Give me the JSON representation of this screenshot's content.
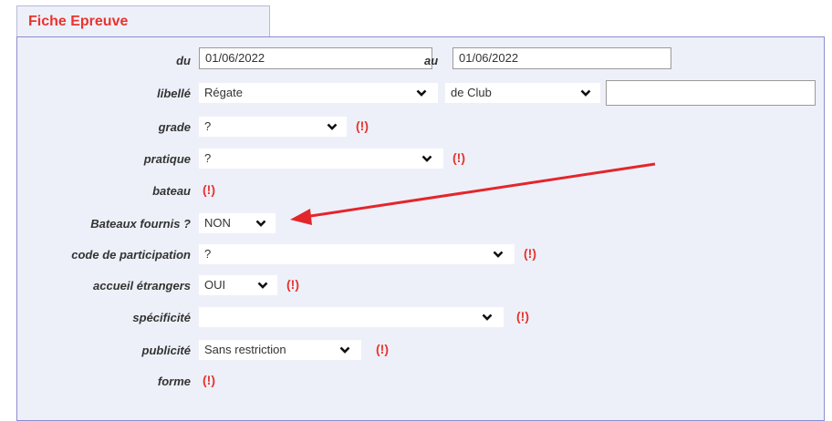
{
  "tab": {
    "title": "Fiche Epreuve"
  },
  "form": {
    "du_label": "du",
    "du_value": "01/06/2022",
    "au_label": "au",
    "au_value": "01/06/2022",
    "libelle_label": "libellé",
    "libelle_value": "Régate",
    "libelle2_value": "de Club",
    "libelle3_value": "",
    "grade_label": "grade",
    "grade_value": "?",
    "pratique_label": "pratique",
    "pratique_value": "?",
    "bateau_label": "bateau",
    "bateaux_fournis_label": "Bateaux fournis ?",
    "bateaux_fournis_value": "NON",
    "code_label": "code de participation",
    "code_value": "?",
    "accueil_label": "accueil étrangers",
    "accueil_value": "OUI",
    "specificite_label": "spécificité",
    "specificite_value": "",
    "publicite_label": "publicité",
    "publicite_value": "Sans restriction",
    "forme_label": "forme",
    "warning": "(!)"
  },
  "colors": {
    "accent": "#e8342f",
    "panel_bg": "#eef0f9",
    "panel_border": "#8a8ed0"
  }
}
